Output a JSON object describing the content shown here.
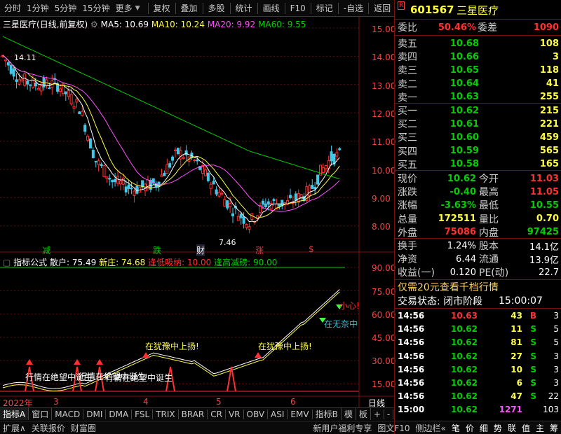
{
  "toolbar": {
    "items": [
      "分时",
      "1分钟",
      "5分钟",
      "15分钟",
      "更多",
      "复权",
      "叠加",
      "多股",
      "统计",
      "画线",
      "F10",
      "标记",
      "-自选",
      "返回"
    ]
  },
  "chart": {
    "title": "三星医疗",
    "mode": "(日线,前复权)",
    "ma5_label": "MA5: 10.69",
    "ma10_label": "MA10: 10.24",
    "ma20_label": "MA20: 9.92",
    "ma60_label": "MA60: 9.55",
    "high_mark": "14.11",
    "low_mark": "7.46",
    "markers": [
      "减",
      "跌",
      "财",
      "涨",
      "$"
    ],
    "colors": {
      "ma5": "#ffffff",
      "ma10": "#ffff40",
      "ma20": "#ff50ff",
      "ma60": "#00d000"
    }
  },
  "indicator": {
    "title": "指标公式",
    "retail": "散户: 75.49",
    "newdealer": "新庄: 74.68",
    "buy_low": "逢低吸纳: 10.00",
    "sell_high": "逢高减磅: 90.00",
    "notes": [
      "行情在绝望中诞生",
      "行情在绝望中诞生",
      "行情在绝望中诞生",
      "在犹豫中上扬!",
      "在犹豫中上扬!",
      "小心!",
      "在无奈中"
    ]
  },
  "price_axis": [
    "15.00",
    "14.00",
    "13.00",
    "12.00",
    "11.00",
    "10.00",
    "9.00",
    "8.00"
  ],
  "ind_axis": [
    "90.00",
    "75.00",
    "60.00",
    "45.00",
    "30.00",
    "15.00"
  ],
  "date_axis": [
    "2022年",
    "3",
    "4",
    "5",
    "6"
  ],
  "period_label": "日线",
  "chart_data": {
    "type": "candlestick",
    "ylim": [
      7.4,
      15.2
    ],
    "ma_lines": [
      "MA5",
      "MA10",
      "MA20",
      "MA60"
    ],
    "indicator_ylim": [
      0,
      100
    ]
  },
  "quote": {
    "code": "601567",
    "name": "三星医疗",
    "weibi_l": "委比",
    "weibi_v": "50.46%",
    "weicha_l": "委差",
    "weicha_v": "1090",
    "asks": [
      {
        "l": "卖五",
        "p": "10.68",
        "v": "108"
      },
      {
        "l": "卖四",
        "p": "10.66",
        "v": "3"
      },
      {
        "l": "卖三",
        "p": "10.65",
        "v": "118"
      },
      {
        "l": "卖二",
        "p": "10.64",
        "v": "41"
      },
      {
        "l": "卖一",
        "p": "10.63",
        "v": "255"
      }
    ],
    "bids": [
      {
        "l": "买一",
        "p": "10.62",
        "v": "215"
      },
      {
        "l": "买二",
        "p": "10.61",
        "v": "221"
      },
      {
        "l": "买三",
        "p": "10.60",
        "v": "459"
      },
      {
        "l": "买四",
        "p": "10.59",
        "v": "565"
      },
      {
        "l": "买五",
        "p": "10.58",
        "v": "165"
      }
    ],
    "stats": [
      {
        "l1": "现价",
        "v1": "10.62",
        "l2": "今开",
        "v2": "11.03"
      },
      {
        "l1": "涨跌",
        "v1": "-0.40",
        "l2": "最高",
        "v2": "11.05"
      },
      {
        "l1": "涨幅",
        "v1": "-3.63%",
        "l2": "最低",
        "v2": "10.55"
      },
      {
        "l1": "总量",
        "v1": "172511",
        "l2": "量比",
        "v2": "0.70"
      },
      {
        "l1": "外盘",
        "v1": "75086",
        "l2": "内盘",
        "v2": "97425"
      }
    ],
    "stats2": [
      {
        "l1": "换手",
        "v1": "1.24%",
        "l2": "股本",
        "v2": "14.1亿"
      },
      {
        "l1": "净资",
        "v1": "6.44",
        "l2": "流通",
        "v2": "13.9亿"
      },
      {
        "l1": "收益(一)",
        "v1": "0.120",
        "l2": "PE(动)",
        "v2": "22.7"
      }
    ],
    "promo": "仅需20元查看千档行情",
    "trade_state": "交易状态: 闭市阶段",
    "trade_time": "15:00:07",
    "ticks": [
      {
        "t": "14:56",
        "p": "10.63",
        "v": "43",
        "f": "B",
        "n": "3"
      },
      {
        "t": "14:56",
        "p": "10.62",
        "v": "11",
        "f": "S",
        "n": "5"
      },
      {
        "t": "14:56",
        "p": "10.62",
        "v": "81",
        "f": "S",
        "n": "5"
      },
      {
        "t": "14:56",
        "p": "10.62",
        "v": "27",
        "f": "S",
        "n": "3"
      },
      {
        "t": "14:56",
        "p": "10.62",
        "v": "10",
        "f": "S",
        "n": "3"
      },
      {
        "t": "14:56",
        "p": "10.62",
        "v": "6",
        "f": "S",
        "n": "3"
      },
      {
        "t": "14:56",
        "p": "10.62",
        "v": "47",
        "f": "S",
        "n": "22"
      },
      {
        "t": "15:00",
        "p": "10.62",
        "v": "1271",
        "f": "",
        "n": "103"
      }
    ]
  },
  "bottom_tabs": [
    "指标A",
    "窗口",
    "MACD",
    "DMI",
    "DMA",
    "FSL",
    "TRIX",
    "BRAR",
    "CR",
    "VR",
    "OBV",
    "ASI",
    "EMV",
    "指标B",
    "模",
    "板",
    "+",
    "-"
  ],
  "status": {
    "items": [
      "扩展∧",
      "关联报价",
      "财富圈"
    ],
    "right": [
      "新用户福利专享",
      "图文F10",
      "侧边栏«"
    ],
    "right2": [
      "笔",
      "价",
      "细",
      "势",
      "联",
      "值",
      "主",
      "筹"
    ]
  }
}
